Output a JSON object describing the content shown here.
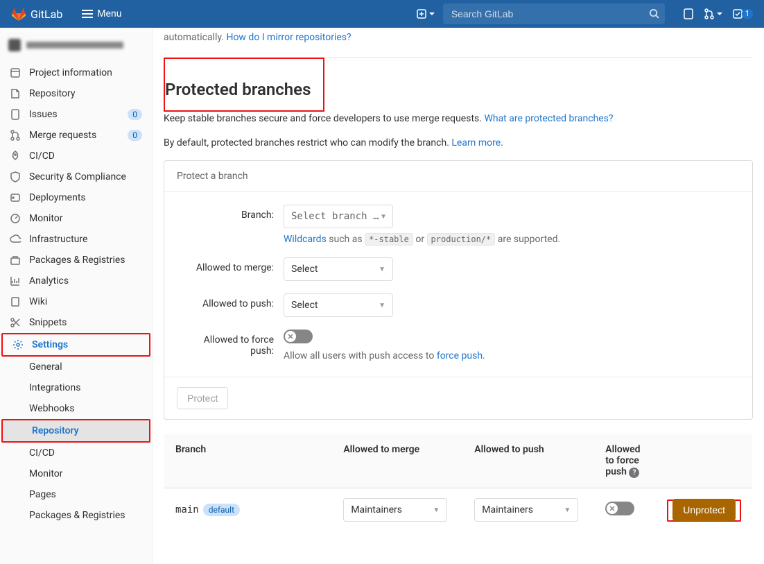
{
  "header": {
    "brand": "GitLab",
    "menu": "Menu",
    "search_placeholder": "Search GitLab",
    "todo_count": "1"
  },
  "sidebar": {
    "items": [
      {
        "label": "Project information"
      },
      {
        "label": "Repository"
      },
      {
        "label": "Issues",
        "count": "0"
      },
      {
        "label": "Merge requests",
        "count": "0"
      },
      {
        "label": "CI/CD"
      },
      {
        "label": "Security & Compliance"
      },
      {
        "label": "Deployments"
      },
      {
        "label": "Monitor"
      },
      {
        "label": "Infrastructure"
      },
      {
        "label": "Packages & Registries"
      },
      {
        "label": "Analytics"
      },
      {
        "label": "Wiki"
      },
      {
        "label": "Snippets"
      },
      {
        "label": "Settings"
      }
    ],
    "sub": [
      "General",
      "Integrations",
      "Webhooks",
      "Repository",
      "CI/CD",
      "Monitor",
      "Pages",
      "Packages & Registries"
    ]
  },
  "intro": {
    "pre": "automatically. ",
    "link": "How do I mirror repositories?"
  },
  "section": {
    "title": "Protected branches",
    "d1a": "Keep stable branches secure and force developers to use merge requests. ",
    "d1l": "What are protected branches?",
    "d2a": "By default, protected branches restrict who can modify the branch. ",
    "d2l": "Learn more"
  },
  "card": {
    "title": "Protect a branch",
    "branch_lbl": "Branch:",
    "branch_sel": "Select branch …",
    "wild_link": "Wildcards",
    "wild_mid": " such as ",
    "wild_c1": "*-stable",
    "wild_or": " or ",
    "wild_c2": "production/*",
    "wild_end": " are supported.",
    "merge_lbl": "Allowed to merge:",
    "push_lbl": "Allowed to push:",
    "force_lbl": "Allowed to force push:",
    "select": "Select",
    "force_hint_a": "Allow all users with push access to ",
    "force_hint_l": "force push",
    "protect": "Protect"
  },
  "table": {
    "h_branch": "Branch",
    "h_merge": "Allowed to merge",
    "h_push": "Allowed to push",
    "h_force": "Allowed to force push",
    "row": {
      "name": "main",
      "badge": "default",
      "merge": "Maintainers",
      "push": "Maintainers",
      "unprotect": "Unprotect"
    }
  }
}
